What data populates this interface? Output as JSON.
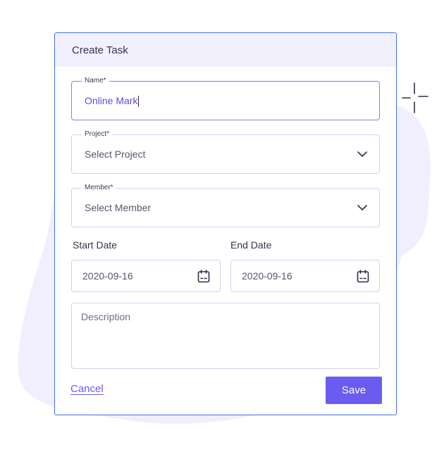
{
  "dialog": {
    "title": "Create Task"
  },
  "fields": {
    "name": {
      "label": "Name*",
      "value": "Online Mark"
    },
    "project": {
      "label": "Project*",
      "placeholder": "Select Project"
    },
    "member": {
      "label": "Member*",
      "placeholder": "Select Member"
    },
    "start_date": {
      "label": "Start Date",
      "value": "2020-09-16"
    },
    "end_date": {
      "label": "End Date",
      "value": "2020-09-16"
    },
    "description": {
      "placeholder": "Description"
    }
  },
  "actions": {
    "cancel_label": "Cancel",
    "save_label": "Save"
  },
  "icons": {
    "project_dropdown": "chevron-down-icon",
    "member_dropdown": "chevron-down-icon",
    "start_calendar": "calendar-icon",
    "end_calendar": "calendar-icon",
    "decoration": "sparkle-icon"
  },
  "colors": {
    "accent": "#6a5cf0",
    "header_bg": "#f2f0fd",
    "input_border": "#d3d0f3",
    "blob": "#f1effd"
  }
}
